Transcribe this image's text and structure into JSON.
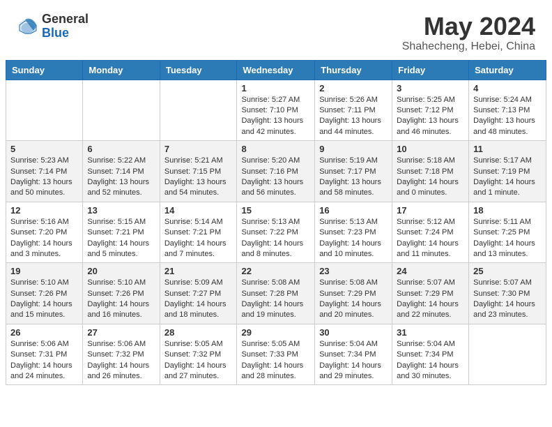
{
  "header": {
    "logo_general": "General",
    "logo_blue": "Blue",
    "month_year": "May 2024",
    "location": "Shahecheng, Hebei, China"
  },
  "days_of_week": [
    "Sunday",
    "Monday",
    "Tuesday",
    "Wednesday",
    "Thursday",
    "Friday",
    "Saturday"
  ],
  "weeks": [
    [
      {
        "day": "",
        "info": ""
      },
      {
        "day": "",
        "info": ""
      },
      {
        "day": "",
        "info": ""
      },
      {
        "day": "1",
        "info": "Sunrise: 5:27 AM\nSunset: 7:10 PM\nDaylight: 13 hours\nand 42 minutes."
      },
      {
        "day": "2",
        "info": "Sunrise: 5:26 AM\nSunset: 7:11 PM\nDaylight: 13 hours\nand 44 minutes."
      },
      {
        "day": "3",
        "info": "Sunrise: 5:25 AM\nSunset: 7:12 PM\nDaylight: 13 hours\nand 46 minutes."
      },
      {
        "day": "4",
        "info": "Sunrise: 5:24 AM\nSunset: 7:13 PM\nDaylight: 13 hours\nand 48 minutes."
      }
    ],
    [
      {
        "day": "5",
        "info": "Sunrise: 5:23 AM\nSunset: 7:14 PM\nDaylight: 13 hours\nand 50 minutes."
      },
      {
        "day": "6",
        "info": "Sunrise: 5:22 AM\nSunset: 7:14 PM\nDaylight: 13 hours\nand 52 minutes."
      },
      {
        "day": "7",
        "info": "Sunrise: 5:21 AM\nSunset: 7:15 PM\nDaylight: 13 hours\nand 54 minutes."
      },
      {
        "day": "8",
        "info": "Sunrise: 5:20 AM\nSunset: 7:16 PM\nDaylight: 13 hours\nand 56 minutes."
      },
      {
        "day": "9",
        "info": "Sunrise: 5:19 AM\nSunset: 7:17 PM\nDaylight: 13 hours\nand 58 minutes."
      },
      {
        "day": "10",
        "info": "Sunrise: 5:18 AM\nSunset: 7:18 PM\nDaylight: 14 hours\nand 0 minutes."
      },
      {
        "day": "11",
        "info": "Sunrise: 5:17 AM\nSunset: 7:19 PM\nDaylight: 14 hours\nand 1 minute."
      }
    ],
    [
      {
        "day": "12",
        "info": "Sunrise: 5:16 AM\nSunset: 7:20 PM\nDaylight: 14 hours\nand 3 minutes."
      },
      {
        "day": "13",
        "info": "Sunrise: 5:15 AM\nSunset: 7:21 PM\nDaylight: 14 hours\nand 5 minutes."
      },
      {
        "day": "14",
        "info": "Sunrise: 5:14 AM\nSunset: 7:21 PM\nDaylight: 14 hours\nand 7 minutes."
      },
      {
        "day": "15",
        "info": "Sunrise: 5:13 AM\nSunset: 7:22 PM\nDaylight: 14 hours\nand 8 minutes."
      },
      {
        "day": "16",
        "info": "Sunrise: 5:13 AM\nSunset: 7:23 PM\nDaylight: 14 hours\nand 10 minutes."
      },
      {
        "day": "17",
        "info": "Sunrise: 5:12 AM\nSunset: 7:24 PM\nDaylight: 14 hours\nand 11 minutes."
      },
      {
        "day": "18",
        "info": "Sunrise: 5:11 AM\nSunset: 7:25 PM\nDaylight: 14 hours\nand 13 minutes."
      }
    ],
    [
      {
        "day": "19",
        "info": "Sunrise: 5:10 AM\nSunset: 7:26 PM\nDaylight: 14 hours\nand 15 minutes."
      },
      {
        "day": "20",
        "info": "Sunrise: 5:10 AM\nSunset: 7:26 PM\nDaylight: 14 hours\nand 16 minutes."
      },
      {
        "day": "21",
        "info": "Sunrise: 5:09 AM\nSunset: 7:27 PM\nDaylight: 14 hours\nand 18 minutes."
      },
      {
        "day": "22",
        "info": "Sunrise: 5:08 AM\nSunset: 7:28 PM\nDaylight: 14 hours\nand 19 minutes."
      },
      {
        "day": "23",
        "info": "Sunrise: 5:08 AM\nSunset: 7:29 PM\nDaylight: 14 hours\nand 20 minutes."
      },
      {
        "day": "24",
        "info": "Sunrise: 5:07 AM\nSunset: 7:29 PM\nDaylight: 14 hours\nand 22 minutes."
      },
      {
        "day": "25",
        "info": "Sunrise: 5:07 AM\nSunset: 7:30 PM\nDaylight: 14 hours\nand 23 minutes."
      }
    ],
    [
      {
        "day": "26",
        "info": "Sunrise: 5:06 AM\nSunset: 7:31 PM\nDaylight: 14 hours\nand 24 minutes."
      },
      {
        "day": "27",
        "info": "Sunrise: 5:06 AM\nSunset: 7:32 PM\nDaylight: 14 hours\nand 26 minutes."
      },
      {
        "day": "28",
        "info": "Sunrise: 5:05 AM\nSunset: 7:32 PM\nDaylight: 14 hours\nand 27 minutes."
      },
      {
        "day": "29",
        "info": "Sunrise: 5:05 AM\nSunset: 7:33 PM\nDaylight: 14 hours\nand 28 minutes."
      },
      {
        "day": "30",
        "info": "Sunrise: 5:04 AM\nSunset: 7:34 PM\nDaylight: 14 hours\nand 29 minutes."
      },
      {
        "day": "31",
        "info": "Sunrise: 5:04 AM\nSunset: 7:34 PM\nDaylight: 14 hours\nand 30 minutes."
      },
      {
        "day": "",
        "info": ""
      }
    ]
  ]
}
